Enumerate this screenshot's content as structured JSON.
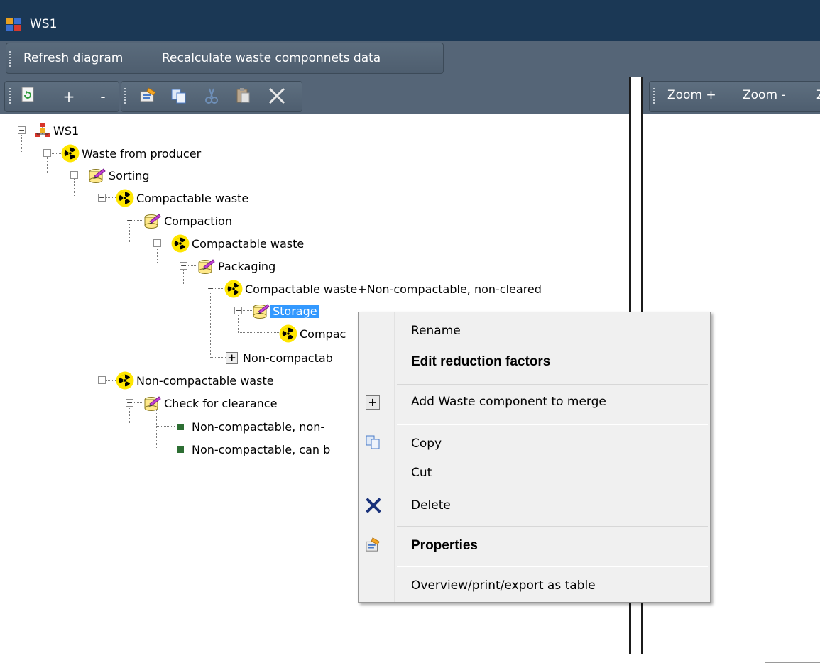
{
  "window": {
    "title": "WS1"
  },
  "menu": {
    "refresh": "Refresh diagram",
    "recalc": "Recalculate waste componnets data"
  },
  "toolbar": {
    "plus": "+",
    "minus": "-"
  },
  "right_toolbar": {
    "zoom_in": "Zoom +",
    "zoom_out": "Zoom -"
  },
  "tree": {
    "root": "WS1",
    "n1": "Waste from producer",
    "n2": "Sorting",
    "n3": "Compactable waste",
    "n4": "Compaction",
    "n5": "Compactable waste",
    "n6": "Packaging",
    "n7": "Compactable waste+Non-compactable, non-cleared",
    "n8": "Storage",
    "n9": "Compac",
    "n10": "Non-compactab",
    "n11": "Non-compactable waste",
    "n12": "Check for clearance",
    "n13": "Non-compactable, non-",
    "n14": "Non-compactable, can b"
  },
  "context_menu": {
    "rename": "Rename",
    "edit_factors": "Edit reduction factors",
    "add_merge": "Add Waste component to merge",
    "copy": "Copy",
    "cut": "Cut",
    "delete": "Delete",
    "properties": "Properties",
    "overview": "Overview/print/export as table"
  },
  "colors": {
    "titlebar": "#1b3855",
    "toolbar": "#556577",
    "selection": "#3399ff",
    "radiation_yellow": "#ffe600"
  }
}
